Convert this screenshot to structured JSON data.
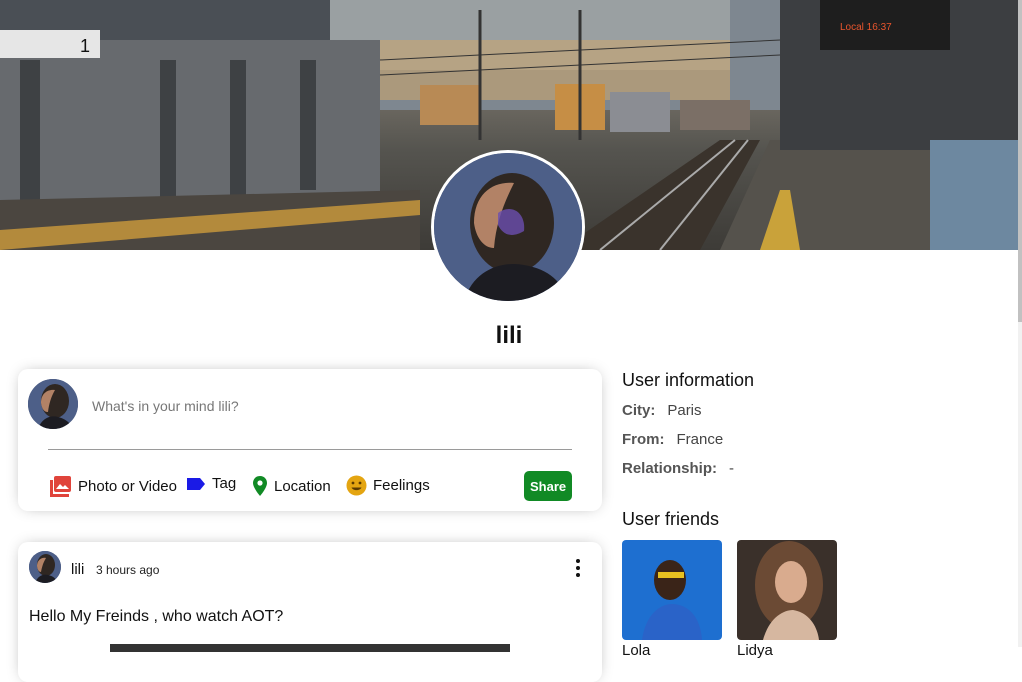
{
  "cover": {
    "image_icon": "train-station-photo"
  },
  "profile": {
    "name": "lili"
  },
  "share": {
    "placeholder": "What's in your mind lili?",
    "options": [
      {
        "label": "Photo or Video",
        "icon": "photo-icon",
        "color": "#e0443b"
      },
      {
        "label": "Tag",
        "icon": "label-icon",
        "color": "#1a1ae6"
      },
      {
        "label": "Location",
        "icon": "location-pin-icon",
        "color": "#118a25"
      },
      {
        "label": "Feelings",
        "icon": "emoji-icon",
        "color": "#e4a511"
      }
    ],
    "share_label": "Share",
    "share_color": "#118a25"
  },
  "post": {
    "username": "lili",
    "time": "3 hours ago",
    "text": "Hello My Freinds , who watch AOT?"
  },
  "user_info": {
    "title": "User information",
    "rows": [
      {
        "key": "City:",
        "value": "Paris"
      },
      {
        "key": "From:",
        "value": "France"
      },
      {
        "key": "Relationship:",
        "value": "-"
      }
    ]
  },
  "friends": {
    "title": "User friends",
    "items": [
      {
        "name": "Lola"
      },
      {
        "name": "Lidya"
      }
    ]
  }
}
